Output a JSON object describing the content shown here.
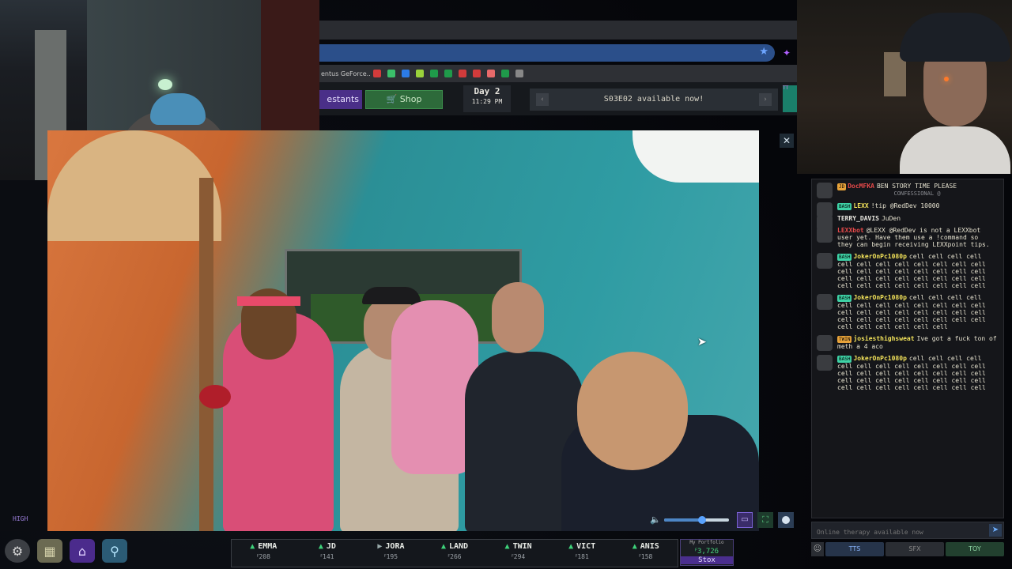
{
  "browser": {
    "bookmark_text": "entus GeForce...",
    "bookmark_colors": [
      "#d23b3b",
      "#3bbf6a",
      "#2c7be5",
      "#9bd23b",
      "#1f9a4a",
      "#1f9a4a",
      "#d23b3b",
      "#d23b3b",
      "#e86a6a",
      "#1f9a4a",
      "#888888"
    ]
  },
  "header": {
    "contestants_label": "estants",
    "shop_label": "Shop",
    "shop_icon": "cart-icon",
    "day_label": "Day 2",
    "day_time": "11:29 PM",
    "ticker_text": "S03E02 available now!",
    "mini_label": "TT"
  },
  "video": {
    "quality_label": "HIGH",
    "volume_fraction": 0.58,
    "close_icon": "close-icon"
  },
  "market": {
    "stocks": [
      {
        "name": "EMMA",
        "price": "ꟳ208",
        "trend": "up"
      },
      {
        "name": "JD",
        "price": "ꟳ141",
        "trend": "up"
      },
      {
        "name": "JORA",
        "price": "ꟳ195",
        "trend": "flat"
      },
      {
        "name": "LAND",
        "price": "ꟳ266",
        "trend": "up"
      },
      {
        "name": "TWIN",
        "price": "ꟳ294",
        "trend": "up"
      },
      {
        "name": "VICT",
        "price": "ꟳ181",
        "trend": "up"
      },
      {
        "name": "ANIS",
        "price": "ꟳ158",
        "trend": "up"
      }
    ],
    "portfolio_label": "My Portfolio",
    "portfolio_value": "ꟳ3,726",
    "stox_label": "Stox"
  },
  "chat": {
    "messages": [
      {
        "badge": "JD",
        "badge_color": "#e8a33a",
        "user": "DocMFKA",
        "user_color": "#e84a4a",
        "text": "BEN STORY TIME PLEASE",
        "sys": "CONFESSIONAL @"
      },
      {
        "badge": "BASH",
        "badge_color": "#3ed2a6",
        "user": "LEXX",
        "user_color": "#f2e25a",
        "text": "!tip @RedDev 10000",
        "sys": ""
      },
      {
        "badge": "",
        "badge_color": "",
        "user": "TERRY_DAVIS",
        "user_color": "#e8e6df",
        "text": "JuDen",
        "sys": ""
      },
      {
        "badge": "",
        "badge_color": "",
        "user": "LEXXbot",
        "user_color": "#e84a4a",
        "text": "@LEXX @RedDev is not a LEXXbot user yet. Have them use a !command so they can begin receiving LEXXpoint tips.",
        "sys": ""
      },
      {
        "badge": "BASH",
        "badge_color": "#3ed2a6",
        "user": "JokerOnPc1080p",
        "user_color": "#f2e25a",
        "text": "cell cell cell cell cell cell cell cell cell cell cell cell cell cell cell cell cell cell cell cell cell cell cell cell cell cell cell cell cell cell cell cell cell cell cell cell",
        "sys": ""
      },
      {
        "badge": "BASH",
        "badge_color": "#3ed2a6",
        "user": "JokerOnPc1080p",
        "user_color": "#f2e25a",
        "text": "cell cell cell cell cell cell cell cell cell cell cell cell cell cell cell cell cell cell cell cell cell cell cell cell cell cell cell cell cell cell cell cell cell cell",
        "sys": ""
      },
      {
        "badge": "TWIN",
        "badge_color": "#e8a33a",
        "user": "josiesthighsweat",
        "user_color": "#f2e25a",
        "text": "Ive got a fuck ton of meth a 4 aco",
        "sys": ""
      },
      {
        "badge": "BASH",
        "badge_color": "#3ed2a6",
        "user": "JokerOnPc1080p",
        "user_color": "#f2e25a",
        "text": "cell cell cell cell cell cell cell cell cell cell cell cell cell cell cell cell cell cell cell cell cell cell cell cell cell cell cell cell cell cell cell cell cell cell cell cell",
        "sys": ""
      }
    ],
    "input_placeholder": "Online therapy available now",
    "tabs": {
      "tts": "TTS",
      "sfx": "SFX",
      "toy": "TOY"
    }
  }
}
